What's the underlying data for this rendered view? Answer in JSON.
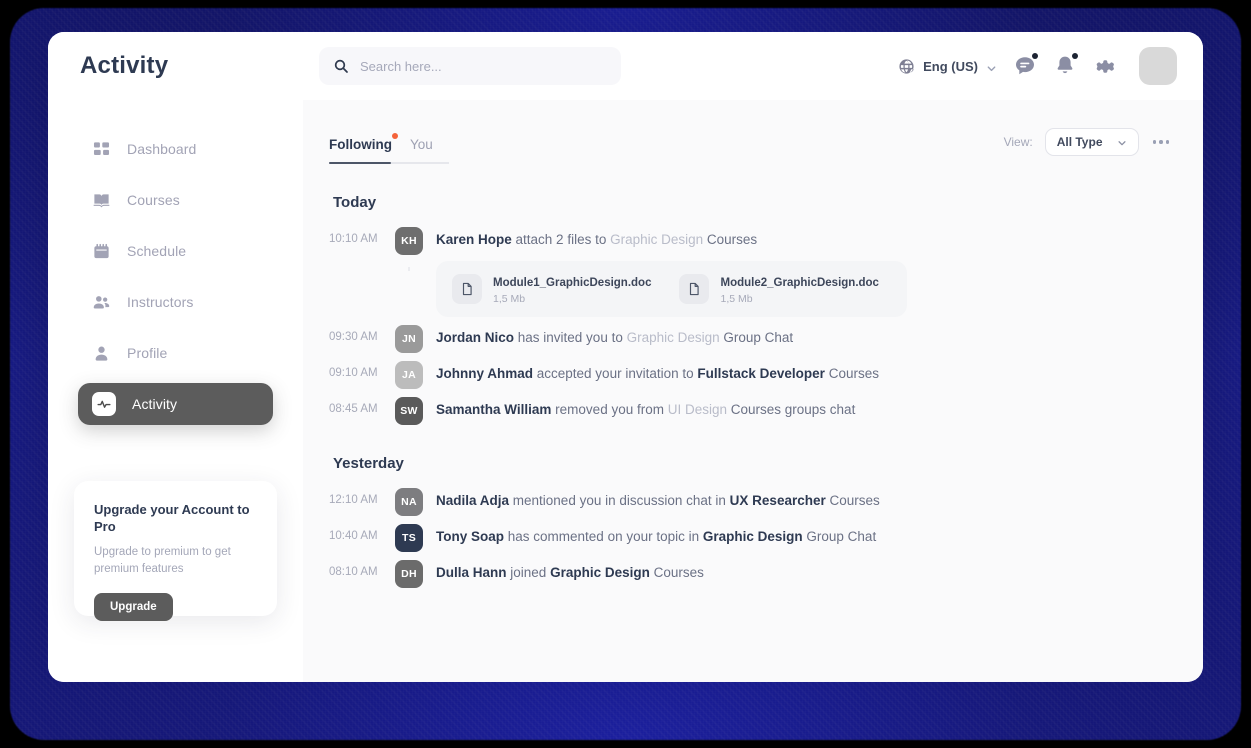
{
  "header": {
    "title": "Activity",
    "search": {
      "placeholder": "Search here...",
      "value": ""
    },
    "language": "Eng (US)",
    "icons": [
      "globe-icon",
      "chevron-down-icon",
      "chat-icon",
      "bell-icon",
      "gear-icon"
    ]
  },
  "sidebar": {
    "items": [
      {
        "label": "Dashboard",
        "icon": "grid-icon",
        "active": false
      },
      {
        "label": "Courses",
        "icon": "book-icon",
        "active": false
      },
      {
        "label": "Schedule",
        "icon": "calendar-icon",
        "active": false
      },
      {
        "label": "Instructors",
        "icon": "people-icon",
        "active": false
      },
      {
        "label": "Profile",
        "icon": "person-icon",
        "active": false
      },
      {
        "label": "Activity",
        "icon": "pulse-icon",
        "active": true
      }
    ],
    "upgrade": {
      "title": "Upgrade your Account to Pro",
      "subtitle": "Upgrade to premium to get premium features",
      "button": "Upgrade"
    }
  },
  "main": {
    "tabs": [
      {
        "label": "Following",
        "active": true,
        "badge": true
      },
      {
        "label": "You",
        "active": false,
        "badge": false
      }
    ],
    "view_label": "View:",
    "view_value": "All Type",
    "groups": [
      {
        "title": "Today",
        "items": [
          {
            "time": "10:10 AM",
            "initials": "KH",
            "avatar_color": "#6e6e6e",
            "parts": [
              {
                "text": "Karen Hope",
                "style": "name"
              },
              {
                "text": " attach 2 files to ",
                "style": "mid"
              },
              {
                "text": "Graphic Design",
                "style": "muted"
              },
              {
                "text": " Courses",
                "style": "mid"
              }
            ],
            "files": [
              {
                "name": "Module1_GraphicDesign.doc",
                "size": "1,5 Mb"
              },
              {
                "name": "Module2_GraphicDesign.doc",
                "size": "1,5 Mb"
              }
            ]
          },
          {
            "time": "09:30 AM",
            "initials": "JN",
            "avatar_color": "#9a9a9a",
            "parts": [
              {
                "text": "Jordan Nico",
                "style": "name"
              },
              {
                "text": " has invited you to ",
                "style": "mid"
              },
              {
                "text": "Graphic Design",
                "style": "muted"
              },
              {
                "text": " Group Chat",
                "style": "mid"
              }
            ],
            "files": []
          },
          {
            "time": "09:10 AM",
            "initials": "JA",
            "avatar_color": "#bcbcbc",
            "parts": [
              {
                "text": "Johnny Ahmad",
                "style": "name"
              },
              {
                "text": " accepted your invitation to ",
                "style": "mid"
              },
              {
                "text": "Fullstack Developer",
                "style": "strong"
              },
              {
                "text": " Courses",
                "style": "mid"
              }
            ],
            "files": []
          },
          {
            "time": "08:45 AM",
            "initials": "SW",
            "avatar_color": "#5a5a5a",
            "parts": [
              {
                "text": "Samantha William",
                "style": "name"
              },
              {
                "text": " removed you from ",
                "style": "mid"
              },
              {
                "text": "UI Design",
                "style": "muted"
              },
              {
                "text": " Courses groups chat",
                "style": "mid"
              }
            ],
            "files": []
          }
        ]
      },
      {
        "title": "Yesterday",
        "items": [
          {
            "time": "12:10 AM",
            "initials": "NA",
            "avatar_color": "#7d7d80",
            "parts": [
              {
                "text": "Nadila Adja",
                "style": "name"
              },
              {
                "text": " mentioned you in discussion chat in ",
                "style": "mid"
              },
              {
                "text": "UX Researcher",
                "style": "strong"
              },
              {
                "text": " Courses",
                "style": "mid"
              }
            ],
            "files": []
          },
          {
            "time": "10:40 AM",
            "initials": "TS",
            "avatar_color": "#2e3a52",
            "parts": [
              {
                "text": "Tony Soap",
                "style": "name"
              },
              {
                "text": " has commented on your topic in ",
                "style": "mid"
              },
              {
                "text": "Graphic Design",
                "style": "strong"
              },
              {
                "text": " Group Chat",
                "style": "mid"
              }
            ],
            "files": []
          },
          {
            "time": "08:10 AM",
            "initials": "DH",
            "avatar_color": "#6b6b6b",
            "parts": [
              {
                "text": "Dulla Hann",
                "style": "name"
              },
              {
                "text": " joined ",
                "style": "mid"
              },
              {
                "text": "Graphic Design",
                "style": "strong"
              },
              {
                "text": " Courses",
                "style": "mid"
              }
            ],
            "files": []
          }
        ]
      }
    ]
  },
  "colors": {
    "accent_badge": "#f4633a",
    "active_nav": "#5c5c5c",
    "title": "#2e3a52",
    "page_bg": "#fafafb"
  }
}
